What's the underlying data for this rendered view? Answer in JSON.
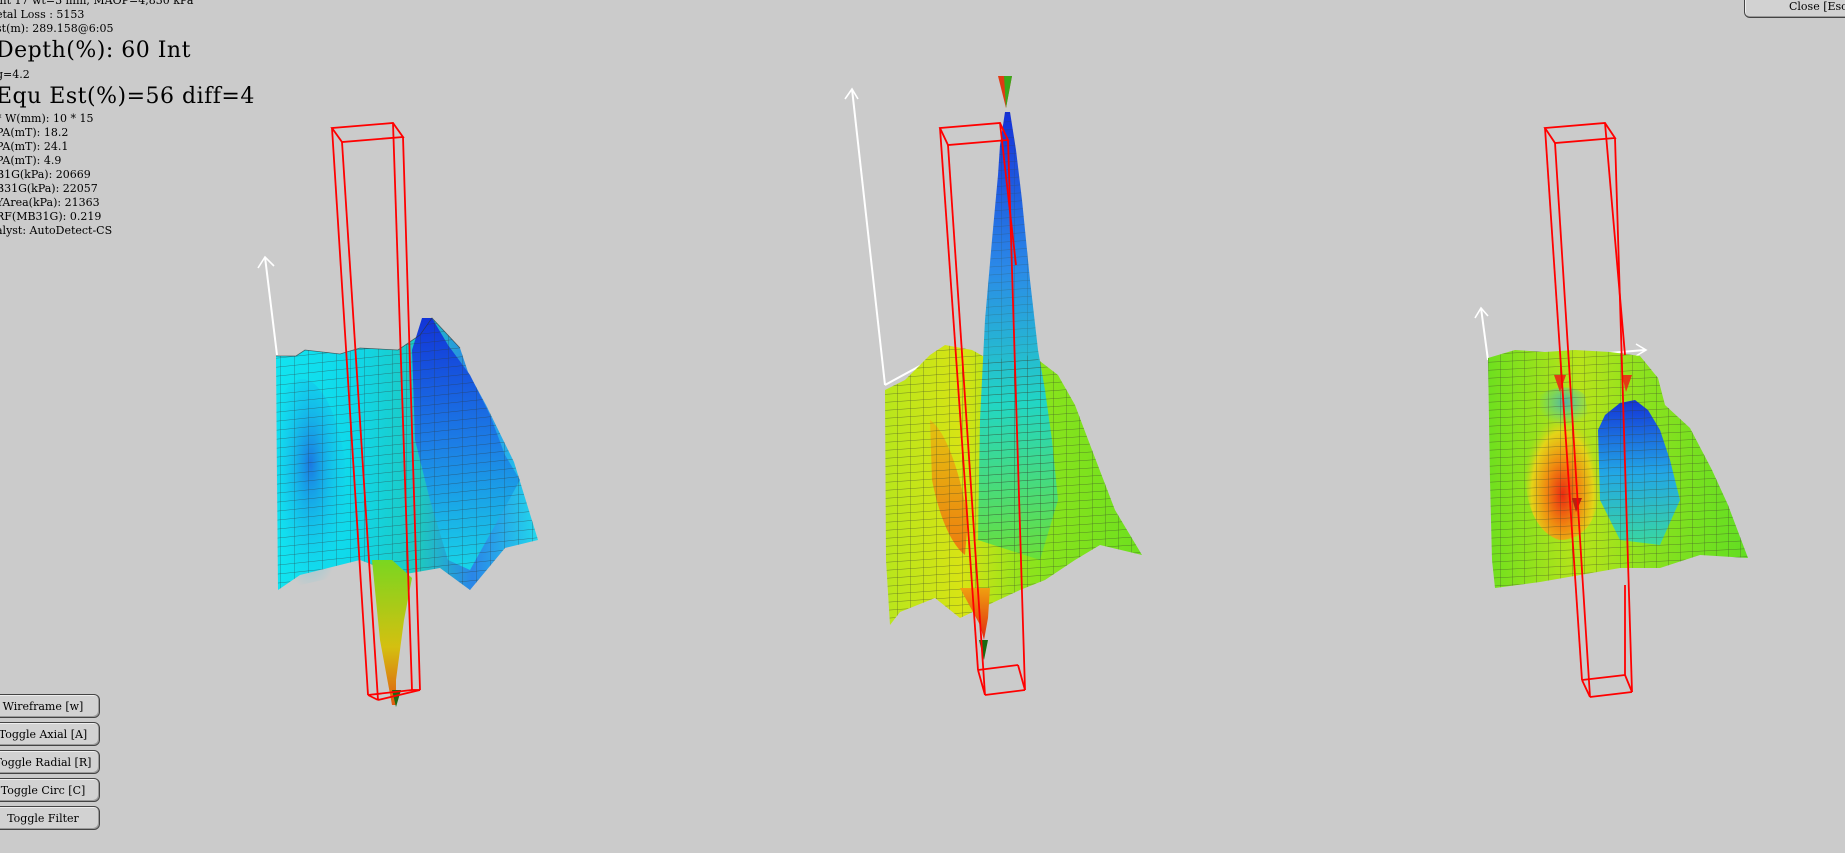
{
  "info_panel": {
    "line_summary": "int 17 wt=3 mm, MAOP=4,830 kPa",
    "metal_loss": "etal Loss : 5153",
    "distance": "st(m): 289.158@6:05",
    "depth": "Depth(%): 60  Int",
    "g_value": "g=4.2",
    "equ_est": "Equ Est(%)=56 diff=4",
    "size": "* W(mm): 10 * 15",
    "pa1": "PA(mT): 18.2",
    "pa2": "PA(mT): 24.1",
    "pa3": "PA(mT): 4.9",
    "b31g": "B1G(kPa): 20669",
    "mb31g": "B31G(kPa): 22057",
    "effarea": "YArea(kPa): 21363",
    "rf": "RF(MB31G): 0.219",
    "analyst": "alyst: AutoDetect-CS"
  },
  "controls": {
    "wireframe": "Wireframe [w]",
    "toggle_axial": "Toggle Axial [A]",
    "toggle_radial": "Toggle Radial [R]",
    "toggle_circ": "Toggle Circ [C]",
    "toggle_filter": "Toggle Filter",
    "close": "Close [Esc]"
  },
  "colors": {
    "background": "#cbcbcb",
    "defect_box": "#ff0000",
    "axis": "#ffffff",
    "grid": "#3a3a3a"
  },
  "surfaces": [
    {
      "name": "axial",
      "palette": "cyan-blue"
    },
    {
      "name": "radial",
      "palette": "green-yellow-blue"
    },
    {
      "name": "circ",
      "palette": "green-yellow-red-blue"
    }
  ]
}
